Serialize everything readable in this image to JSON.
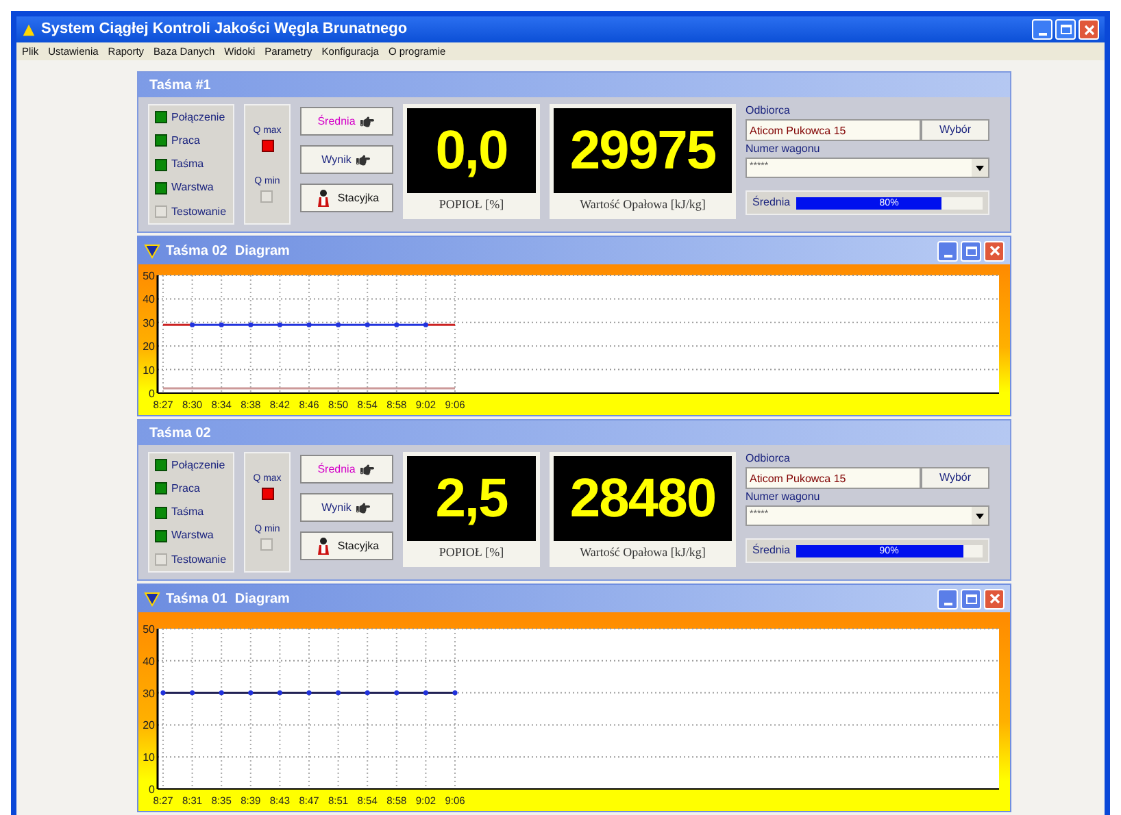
{
  "window": {
    "title": "System Ciągłej Kontroli Jakości Węgla Brunatnego"
  },
  "menu": [
    "Plik",
    "Ustawienia",
    "Raporty",
    "Baza Danych",
    "Widoki",
    "Parametry",
    "Konfiguracja",
    "O programie"
  ],
  "panels": [
    {
      "kind": "belt",
      "title": "Taśma #1",
      "indicators": [
        {
          "label": "Połączenie",
          "on": true
        },
        {
          "label": "Praca",
          "on": true
        },
        {
          "label": "Taśma",
          "on": true
        },
        {
          "label": "Warstwa",
          "on": true
        },
        {
          "label": "Testowanie",
          "on": false
        }
      ],
      "quality": [
        {
          "label": "Q max",
          "on": true
        },
        {
          "label": "Q min",
          "on": false
        }
      ],
      "buttons": [
        {
          "label": "Średnia",
          "kind": "average"
        },
        {
          "label": "Wynik",
          "kind": "result"
        },
        {
          "label": "Stacyjka",
          "kind": "station"
        }
      ],
      "ash": {
        "value": "0,0",
        "label": "POPIOŁ [%]"
      },
      "calorific": {
        "value": "29975",
        "label": "Wartość Opałowa [kJ/kg]"
      },
      "recipient": {
        "label": "Odbiorca",
        "value": "Aticom Pukowca 15",
        "button": "Wybór"
      },
      "wagon": {
        "label": "Numer wagonu",
        "value": "*****"
      },
      "average": {
        "label": "Średnia",
        "level": 0.78,
        "reading": "80%"
      }
    },
    {
      "kind": "diagram",
      "title": "Taśma 02  Diagram",
      "chart_data": {
        "type": "line",
        "categories": [
          "8:27",
          "8:30",
          "8:34",
          "8:38",
          "8:42",
          "8:46",
          "8:50",
          "8:54",
          "8:58",
          "9:02",
          "9:06"
        ],
        "ylim": [
          0,
          50
        ],
        "yticks": [
          0,
          10,
          20,
          30,
          40,
          50
        ],
        "grid": true,
        "series": [
          {
            "color": "#cc2222",
            "values": [
              29,
              29,
              null,
              null,
              null,
              null,
              null,
              null,
              null,
              29,
              29
            ]
          },
          {
            "color": "#2233dd",
            "marker": "circle",
            "values": [
              null,
              29,
              29,
              29,
              29,
              29,
              29,
              29,
              29,
              29,
              null
            ]
          },
          {
            "color": "#cc9999",
            "values": [
              2,
              2,
              2,
              2,
              2,
              2,
              2,
              2,
              2,
              2,
              2
            ]
          }
        ]
      }
    },
    {
      "kind": "belt",
      "title": "Taśma 02",
      "indicators": [
        {
          "label": "Połączenie",
          "on": true
        },
        {
          "label": "Praca",
          "on": true
        },
        {
          "label": "Taśma",
          "on": true
        },
        {
          "label": "Warstwa",
          "on": true
        },
        {
          "label": "Testowanie",
          "on": false
        }
      ],
      "quality": [
        {
          "label": "Q max",
          "on": true
        },
        {
          "label": "Q min",
          "on": false
        }
      ],
      "buttons": [
        {
          "label": "Średnia",
          "kind": "average"
        },
        {
          "label": "Wynik",
          "kind": "result"
        },
        {
          "label": "Stacyjka",
          "kind": "station"
        }
      ],
      "ash": {
        "value": "2,5",
        "label": "POPIOŁ [%]"
      },
      "calorific": {
        "value": "28480",
        "label": "Wartość Opałowa [kJ/kg]"
      },
      "recipient": {
        "label": "Odbiorca",
        "value": "Aticom Pukowca 15",
        "button": "Wybór"
      },
      "wagon": {
        "label": "Numer wagonu",
        "value": "*****"
      },
      "average": {
        "label": "Średnia",
        "level": 0.9,
        "reading": "90%"
      }
    },
    {
      "kind": "diagram",
      "title": "Taśma 01  Diagram",
      "chart_data": {
        "type": "line",
        "categories": [
          "8:27",
          "8:31",
          "8:35",
          "8:39",
          "8:43",
          "8:47",
          "8:51",
          "8:54",
          "8:58",
          "9:02",
          "9:06"
        ],
        "ylim": [
          0,
          50
        ],
        "yticks": [
          0,
          10,
          20,
          30,
          40,
          50
        ],
        "grid": true,
        "series": [
          {
            "color": "#222255",
            "marker": "circle",
            "values": [
              30,
              30,
              30,
              30,
              30,
              30,
              30,
              30,
              30,
              30,
              30
            ]
          }
        ]
      }
    }
  ]
}
